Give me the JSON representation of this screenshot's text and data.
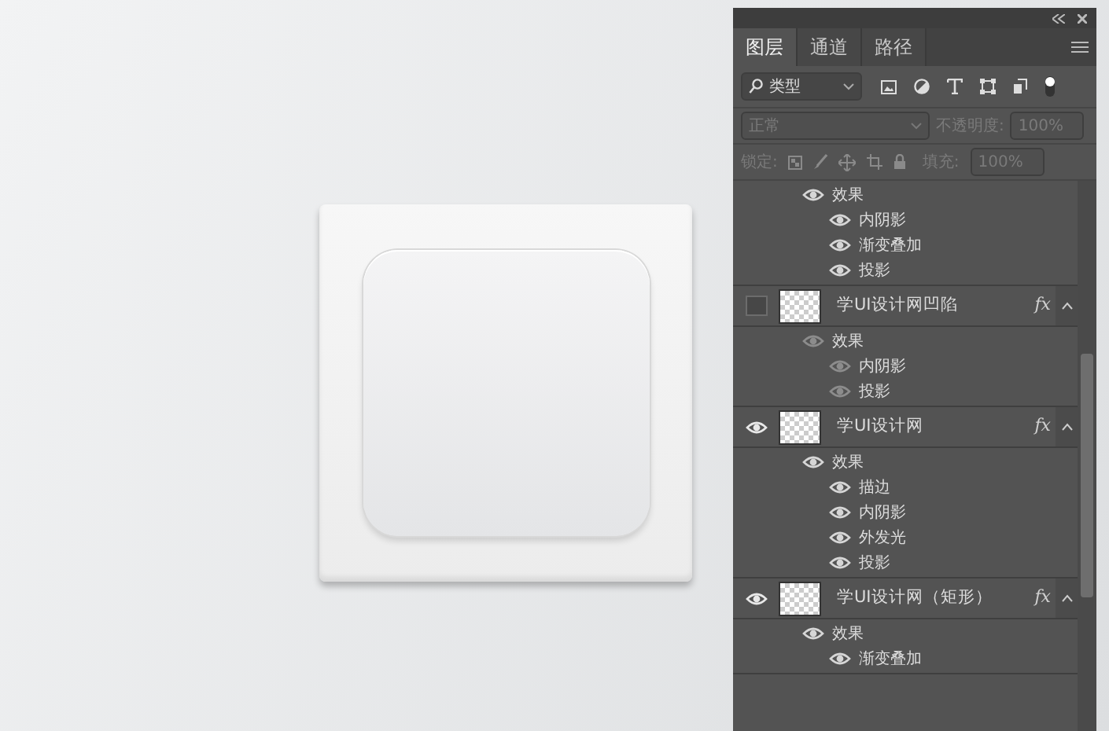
{
  "panel": {
    "tabs": [
      {
        "label": "图层",
        "selected": true
      },
      {
        "label": "通道",
        "selected": false
      },
      {
        "label": "路径",
        "selected": false
      }
    ],
    "filter": {
      "value": "类型"
    },
    "blend_mode": {
      "value": "正常"
    },
    "opacity_label": "不透明度:",
    "opacity": "100%",
    "lock_label": "锁定:",
    "fill_label": "填充:",
    "fill": "100%",
    "layers": [
      {
        "effects": {
          "label": "效果",
          "children": [
            "内阴影",
            "渐变叠加",
            "投影"
          ]
        }
      },
      {
        "name": "学UI设计网凹陷",
        "visible": false,
        "fx": "fx",
        "effects": {
          "label": "效果",
          "children": [
            "内阴影",
            "投影"
          ]
        }
      },
      {
        "name": "学UI设计网",
        "visible": true,
        "fx": "fx",
        "effects": {
          "label": "效果",
          "children": [
            "描边",
            "内阴影",
            "外发光",
            "投影"
          ]
        }
      },
      {
        "name": "学UI设计网（矩形）",
        "visible": true,
        "fx": "fx",
        "effects": {
          "label": "效果",
          "children": [
            "渐变叠加"
          ]
        }
      }
    ]
  }
}
